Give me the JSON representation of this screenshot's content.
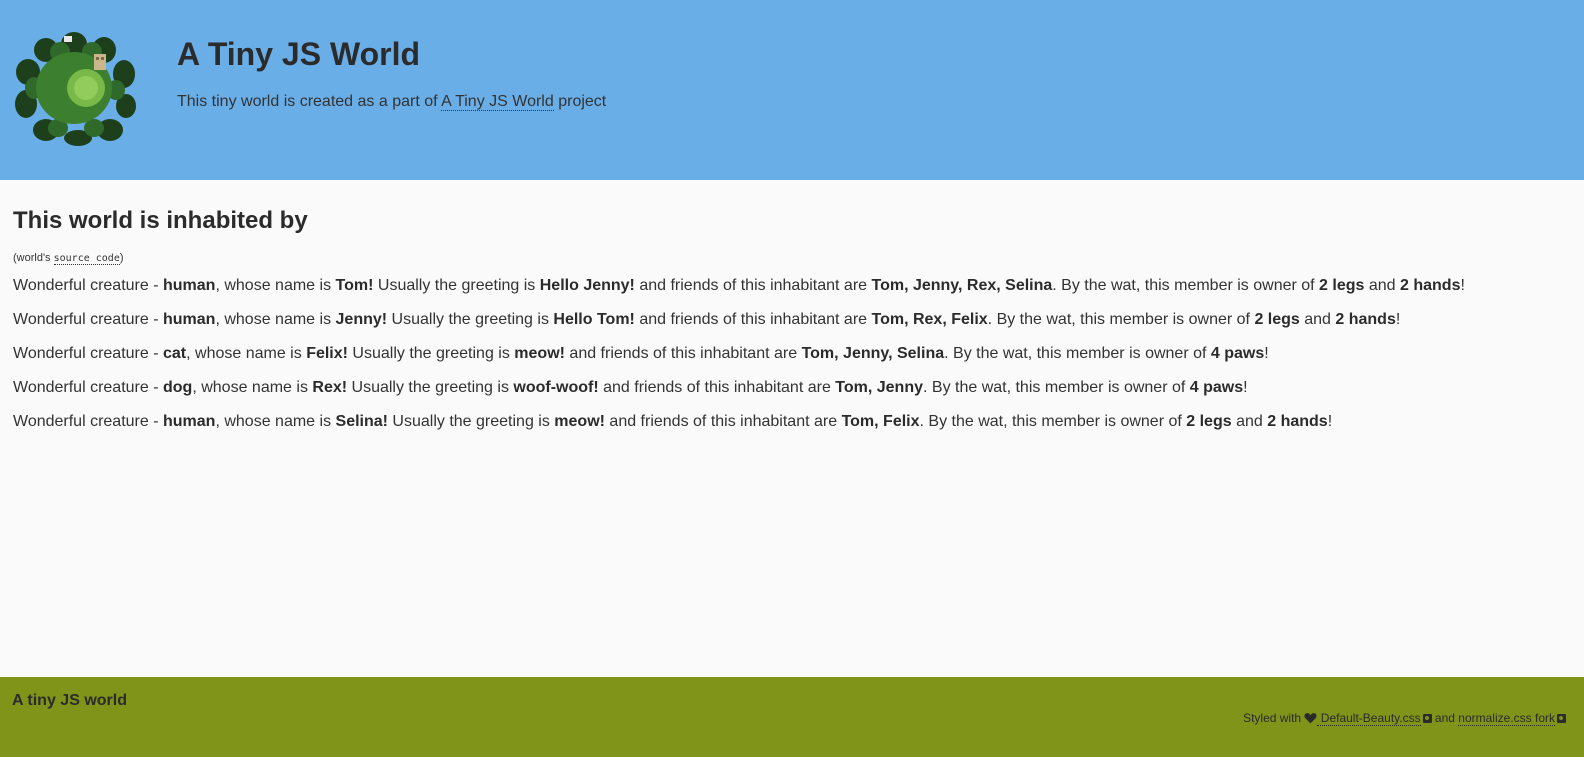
{
  "header": {
    "logo_icon": "tiny-planet-globe-icon",
    "title": "A Tiny JS World",
    "subtitle_prefix": "This tiny world is created as a part of ",
    "subtitle_link": "A Tiny JS World",
    "subtitle_suffix": " project"
  },
  "main": {
    "title": "This world is inhabited by",
    "source_prefix": "(world's ",
    "source_link": "source code",
    "source_suffix": ")",
    "phrases": {
      "intro": "Wonderful creature - ",
      "name": ", whose name is ",
      "greeting": " Usually the greeting is ",
      "friends": " and friends of this inhabitant are ",
      "owner": ". By the wat, this member is owner of ",
      "and": " and ",
      "end": "!"
    },
    "inhabitants": [
      {
        "species": "human",
        "name": "Tom!",
        "greeting": "Hello Jenny!",
        "friends": "Tom, Jenny, Rex, Selina",
        "parts": [
          "2 legs",
          "2 hands"
        ]
      },
      {
        "species": "human",
        "name": "Jenny!",
        "greeting": "Hello Tom!",
        "friends": "Tom, Rex, Felix",
        "parts": [
          "2 legs",
          "2 hands"
        ]
      },
      {
        "species": "cat",
        "name": "Felix!",
        "greeting": "meow!",
        "friends": "Tom, Jenny, Selina",
        "parts": [
          "4 paws"
        ]
      },
      {
        "species": "dog",
        "name": "Rex!",
        "greeting": "woof-woof!",
        "friends": "Tom, Jenny",
        "parts": [
          "4 paws"
        ]
      },
      {
        "species": "human",
        "name": "Selina!",
        "greeting": "meow!",
        "friends": "Tom, Felix",
        "parts": [
          "2 legs",
          "2 hands"
        ]
      }
    ]
  },
  "footer": {
    "title": "A tiny JS world",
    "credits_prefix": "Styled with ",
    "heart_icon": "heart-icon",
    "link1": " Default-Beauty.css",
    "and": " and ",
    "link2": "normalize.css fork",
    "link_icon": "github-icon"
  },
  "colors": {
    "header_bg": "#6aaee8",
    "page_bg": "#fafafa",
    "footer_bg": "#7f9419",
    "text": "#333333"
  }
}
